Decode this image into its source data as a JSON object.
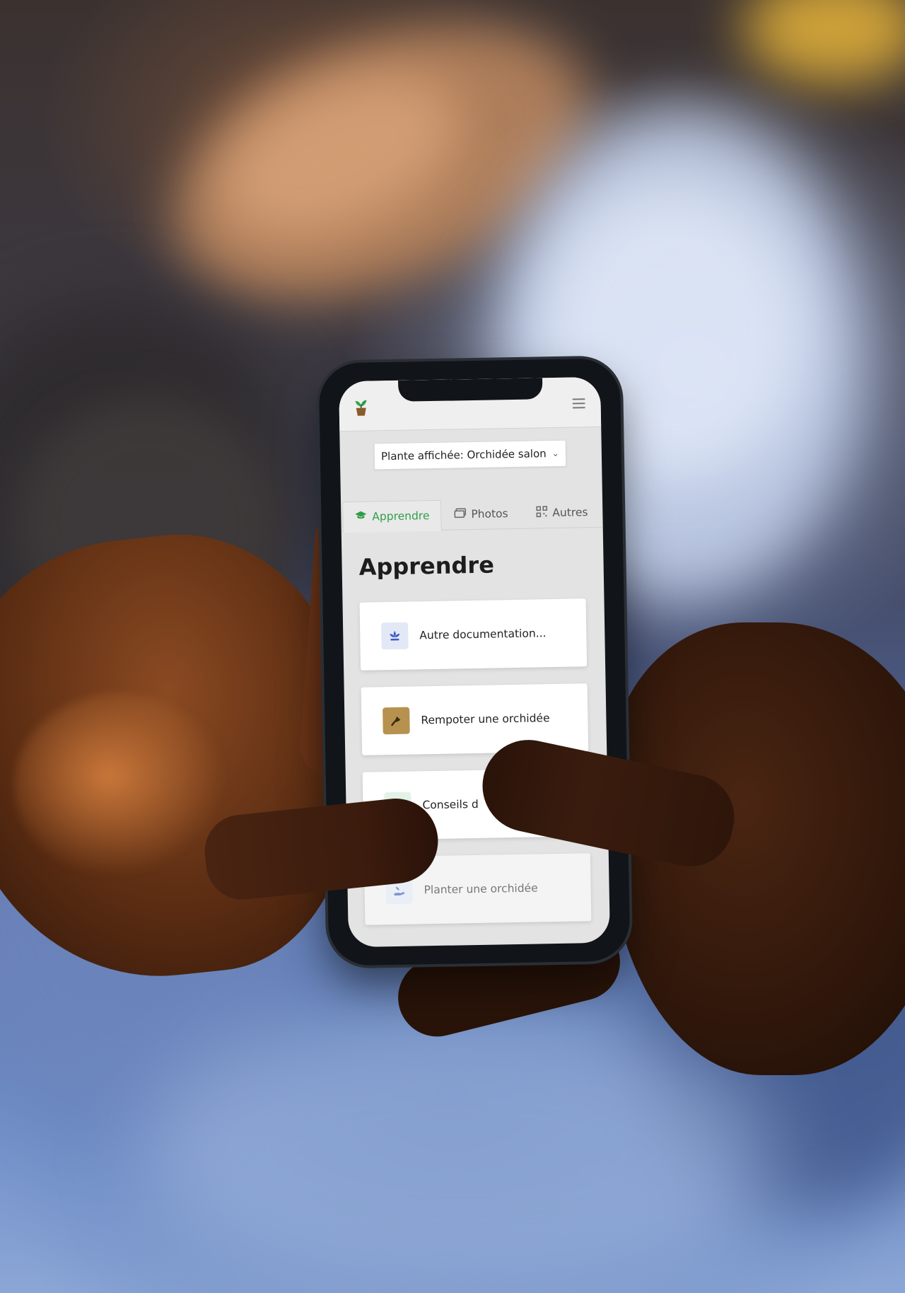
{
  "app": {
    "logo_icon": "seedling-pot-icon",
    "menu_icon": "hamburger-menu-icon"
  },
  "plant_selector": {
    "label": "Plante affichée: Orchidée salon",
    "icon": "chevron-down-icon"
  },
  "tabs": [
    {
      "label": "Apprendre",
      "icon": "graduation-cap-icon",
      "active": true
    },
    {
      "label": "Photos",
      "icon": "images-icon",
      "active": false
    },
    {
      "label": "Autres",
      "icon": "qr-code-icon",
      "active": false
    }
  ],
  "section": {
    "title": "Apprendre"
  },
  "cards": [
    {
      "label": "Autre documentation...",
      "icon": "flower-lotus-icon"
    },
    {
      "label": "Rempoter une orchidée",
      "icon": "trowel-icon"
    },
    {
      "label": "Conseils d",
      "icon": "leaf-icon"
    },
    {
      "label": "Planter une orchidée",
      "icon": "hand-seedling-icon"
    }
  ],
  "colors": {
    "accent_green": "#2e9e47",
    "screen_bg": "#e3e3e3",
    "card_bg": "#ffffff"
  }
}
